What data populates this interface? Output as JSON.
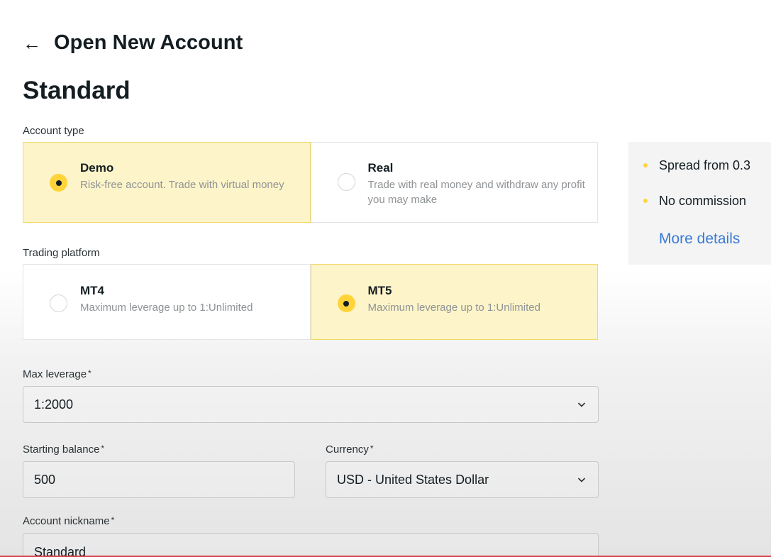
{
  "header": {
    "back_icon": "arrow-left-icon",
    "title": "Open New Account"
  },
  "plan_title": "Standard",
  "account_type": {
    "label": "Account type",
    "options": [
      {
        "title": "Demo",
        "description": "Risk-free account. Trade with virtual money",
        "selected": true
      },
      {
        "title": "Real",
        "description": "Trade with real money and withdraw any profit you may make",
        "selected": false
      }
    ]
  },
  "trading_platform": {
    "label": "Trading platform",
    "options": [
      {
        "title": "MT4",
        "description": "Maximum leverage up to 1:Unlimited",
        "selected": false
      },
      {
        "title": "MT5",
        "description": "Maximum leverage up to 1:Unlimited",
        "selected": true
      }
    ]
  },
  "form": {
    "max_leverage": {
      "label": "Max leverage",
      "required_mark": "*",
      "value": "1:2000"
    },
    "starting_balance": {
      "label": "Starting balance",
      "required_mark": "*",
      "value": "500"
    },
    "currency": {
      "label": "Currency",
      "required_mark": "*",
      "value": "USD - United States Dollar"
    },
    "nickname": {
      "label": "Account nickname",
      "required_mark": "*",
      "value": "Standard"
    }
  },
  "sidebar": {
    "features": [
      "Spread from 0.3",
      "No commission"
    ],
    "more_link": "More details"
  },
  "colors": {
    "accent": "#ffd43b",
    "selected_bg": "#fdf4c9",
    "link": "#3a7bd5"
  }
}
